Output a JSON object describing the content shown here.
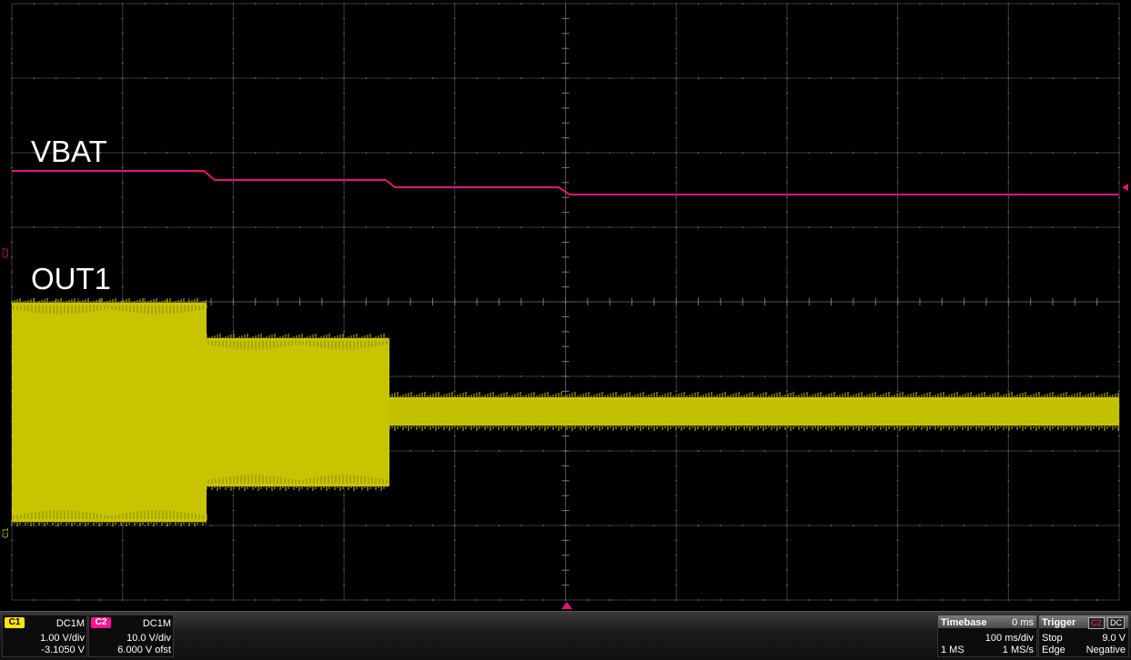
{
  "traces": {
    "vbat_label": "VBAT",
    "out1_label": "OUT1",
    "c2_axis_tag": "C2",
    "c1_axis_tag": "C1",
    "c2_color": "#e0157a",
    "c1_color": "#c8c400"
  },
  "channel1": {
    "name": "C1",
    "coupling": "DC1M",
    "volts_per_div": "1.00 V/div",
    "offset": "-3.1050 V",
    "color": "#ffe500"
  },
  "channel2": {
    "name": "C2",
    "coupling": "DC1M",
    "volts_per_div": "10.0 V/div",
    "offset": "6.000 V ofst",
    "color": "#ff1493"
  },
  "timebase": {
    "title": "Timebase",
    "delay": "0 ms",
    "time_per_div": "100 ms/div",
    "memory": "1 MS",
    "sample_rate": "1 MS/s"
  },
  "trigger": {
    "title": "Trigger",
    "source": "C2",
    "coupling": "DC",
    "mode": "Stop",
    "level": "9.0 V",
    "type": "Edge",
    "slope": "Negative"
  }
}
